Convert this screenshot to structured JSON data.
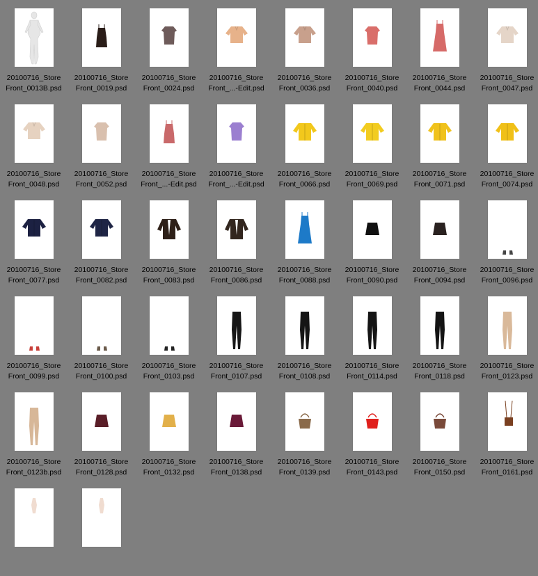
{
  "window": {
    "background": "#7f7f7f"
  },
  "files": [
    {
      "line1": "20100716_Store",
      "line2": "Front_0013B.psd",
      "icon": "mannequin-icon",
      "color": "#e8e8e8"
    },
    {
      "line1": "20100716_Store",
      "line2": "Front_0019.psd",
      "icon": "camisole-icon",
      "color": "#2a1d18"
    },
    {
      "line1": "20100716_Store",
      "line2": "Front_0024.psd",
      "icon": "top-icon",
      "color": "#6e5b5a"
    },
    {
      "line1": "20100716_Store",
      "line2": "Front_...-Edit.psd",
      "icon": "blouse-icon",
      "color": "#e7b28a"
    },
    {
      "line1": "20100716_Store",
      "line2": "Front_0036.psd",
      "icon": "blouse-icon",
      "color": "#c8a08c"
    },
    {
      "line1": "20100716_Store",
      "line2": "Front_0040.psd",
      "icon": "top-icon",
      "color": "#d96e6a"
    },
    {
      "line1": "20100716_Store",
      "line2": "Front_0044.psd",
      "icon": "dress-icon",
      "color": "#d66a68"
    },
    {
      "line1": "20100716_Store",
      "line2": "Front_0047.psd",
      "icon": "blouse-icon",
      "color": "#e5d5c8"
    },
    {
      "line1": "20100716_Store",
      "line2": "Front_0048.psd",
      "icon": "blouse-icon",
      "color": "#e6d2c0"
    },
    {
      "line1": "20100716_Store",
      "line2": "Front_0052.psd",
      "icon": "top-icon",
      "color": "#d9c0ae"
    },
    {
      "line1": "20100716_Store",
      "line2": "Front_...-Edit.psd",
      "icon": "camisole-icon",
      "color": "#c9696a"
    },
    {
      "line1": "20100716_Store",
      "line2": "Front_...-Edit.psd",
      "icon": "top-icon",
      "color": "#9b7fd0"
    },
    {
      "line1": "20100716_Store",
      "line2": "Front_0066.psd",
      "icon": "jacket-icon",
      "color": "#f2c81c"
    },
    {
      "line1": "20100716_Store",
      "line2": "Front_0069.psd",
      "icon": "jacket-icon",
      "color": "#f2cc20"
    },
    {
      "line1": "20100716_Store",
      "line2": "Front_0071.psd",
      "icon": "jacket-icon",
      "color": "#f0c21c"
    },
    {
      "line1": "20100716_Store",
      "line2": "Front_0074.psd",
      "icon": "jacket-icon",
      "color": "#f0c018"
    },
    {
      "line1": "20100716_Store",
      "line2": "Front_0077.psd",
      "icon": "jacket-icon",
      "color": "#1c2142"
    },
    {
      "line1": "20100716_Store",
      "line2": "Front_0082.psd",
      "icon": "jacket-icon",
      "color": "#1f2545"
    },
    {
      "line1": "20100716_Store",
      "line2": "Front_0083.psd",
      "icon": "cardigan-icon",
      "color": "#2e2018"
    },
    {
      "line1": "20100716_Store",
      "line2": "Front_0086.psd",
      "icon": "cardigan-icon",
      "color": "#32261e"
    },
    {
      "line1": "20100716_Store",
      "line2": "Front_0088.psd",
      "icon": "dress-icon",
      "color": "#1d7ac8"
    },
    {
      "line1": "20100716_Store",
      "line2": "Front_0090.psd",
      "icon": "skirt-icon",
      "color": "#111111"
    },
    {
      "line1": "20100716_Store",
      "line2": "Front_0094.psd",
      "icon": "skirt-icon",
      "color": "#2a2220"
    },
    {
      "line1": "20100716_Store",
      "line2": "Front_0096.psd",
      "icon": "shoes-icon",
      "color": "#444444"
    },
    {
      "line1": "20100716_Store",
      "line2": "Front_0099.psd",
      "icon": "shoes-icon",
      "color": "#c8403a"
    },
    {
      "line1": "20100716_Store",
      "line2": "Front_0100.psd",
      "icon": "shoes-icon",
      "color": "#6a5a4a"
    },
    {
      "line1": "20100716_Store",
      "line2": "Front_0103.psd",
      "icon": "shoes-icon",
      "color": "#222222"
    },
    {
      "line1": "20100716_Store",
      "line2": "Front_0107.psd",
      "icon": "pants-icon",
      "color": "#161616"
    },
    {
      "line1": "20100716_Store",
      "line2": "Front_0108.psd",
      "icon": "pants-icon",
      "color": "#151515"
    },
    {
      "line1": "20100716_Store",
      "line2": "Front_0114.psd",
      "icon": "pants-icon",
      "color": "#141414"
    },
    {
      "line1": "20100716_Store",
      "line2": "Front_0118.psd",
      "icon": "pants-icon",
      "color": "#141414"
    },
    {
      "line1": "20100716_Store",
      "line2": "Front_0123.psd",
      "icon": "pants-icon",
      "color": "#d9b99a"
    },
    {
      "line1": "20100716_Store",
      "line2": "Front_0123b.psd",
      "icon": "pants-icon",
      "color": "#d7b798"
    },
    {
      "line1": "20100716_Store",
      "line2": "Front_0128.psd",
      "icon": "skirt-icon",
      "color": "#5a1e28"
    },
    {
      "line1": "20100716_Store",
      "line2": "Front_0132.psd",
      "icon": "skirt-icon",
      "color": "#e2b04a"
    },
    {
      "line1": "20100716_Store",
      "line2": "Front_0138.psd",
      "icon": "skirt-icon",
      "color": "#6a1a38"
    },
    {
      "line1": "20100716_Store",
      "line2": "Front_0139.psd",
      "icon": "handbag-icon",
      "color": "#8a6a4a"
    },
    {
      "line1": "20100716_Store",
      "line2": "Front_0143.psd",
      "icon": "handbag-icon",
      "color": "#e0201c"
    },
    {
      "line1": "20100716_Store",
      "line2": "Front_0150.psd",
      "icon": "handbag-icon",
      "color": "#7a4a3a"
    },
    {
      "line1": "20100716_Store",
      "line2": "Front_0161.psd",
      "icon": "crossbody-bag-icon",
      "color": "#7a4020"
    },
    {
      "line1": "",
      "line2": "",
      "icon": "faint-garment-icon",
      "color": "#f0dcd0"
    },
    {
      "line1": "",
      "line2": "",
      "icon": "faint-garment-icon",
      "color": "#f0dcd0"
    }
  ]
}
